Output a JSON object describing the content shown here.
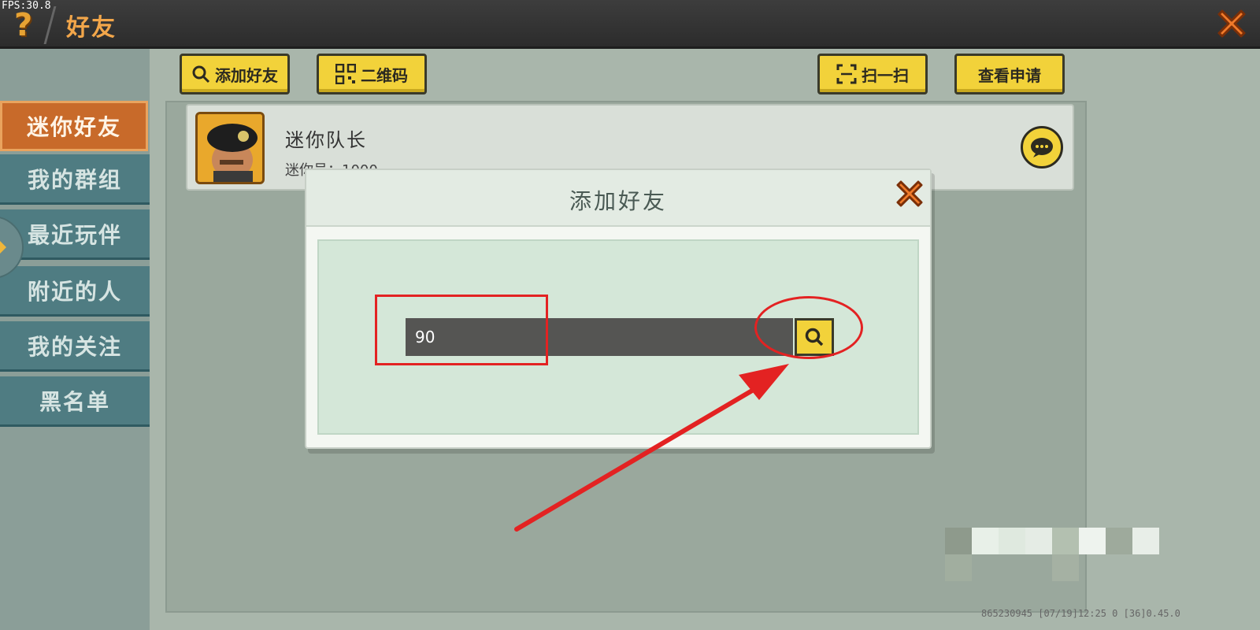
{
  "topbar": {
    "fps": "FPS:30.8",
    "title": "好友"
  },
  "sidebar": {
    "items": [
      {
        "label": "迷你好友",
        "active": true
      },
      {
        "label": "我的群组",
        "active": false
      },
      {
        "label": "最近玩伴",
        "active": false
      },
      {
        "label": "附近的人",
        "active": false
      },
      {
        "label": "我的关注",
        "active": false
      },
      {
        "label": "黑名单",
        "active": false
      }
    ]
  },
  "toolbar": {
    "add_friend": "添加好友",
    "qr_code": "二维码",
    "scan": "扫一扫",
    "view_requests": "查看申请"
  },
  "friend": {
    "name": "迷你队长",
    "id_text": "迷你号：1000"
  },
  "dialog": {
    "title": "添加好友",
    "input_value": "90"
  },
  "status": {
    "text": "865230945    [07/19]12:25 0  [36]0.45.0"
  },
  "colors": {
    "accent_yellow": "#f2d23a",
    "sidebar_active": "#c86a2a",
    "sidebar_item": "#4f7c82",
    "annotation_red": "#e32222"
  }
}
